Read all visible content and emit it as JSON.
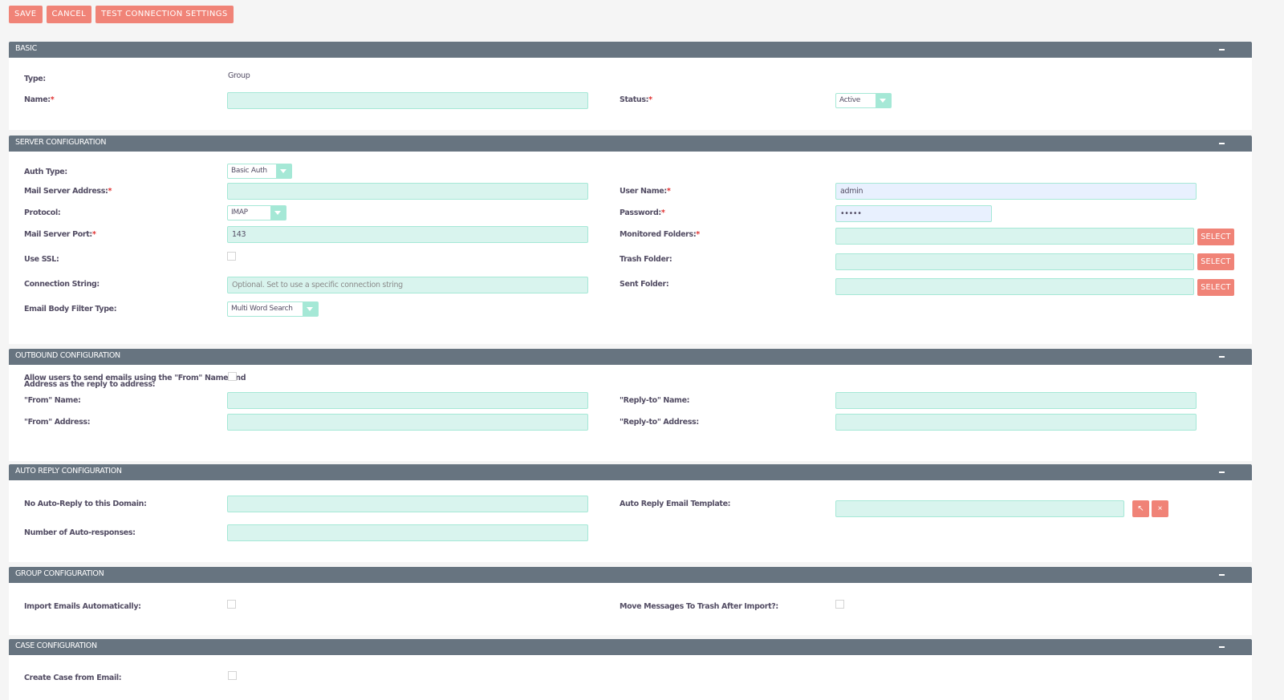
{
  "toolbar": {
    "save_label": "SAVE",
    "cancel_label": "CANCEL",
    "test_label": "TEST CONNECTION SETTINGS"
  },
  "basic": {
    "title": "BASIC",
    "type_label": "Type:",
    "type_value": "Group",
    "name_label": "Name:",
    "name_value": "",
    "status_label": "Status:",
    "status_value": "Active"
  },
  "server": {
    "title": "SERVER CONFIGURATION",
    "auth_type_label": "Auth Type:",
    "auth_type_value": "Basic Auth",
    "mail_server_address_label": "Mail Server Address:",
    "mail_server_address_value": "",
    "protocol_label": "Protocol:",
    "protocol_value": "IMAP",
    "port_label": "Mail Server Port:",
    "port_value": "143",
    "use_ssl_label": "Use SSL:",
    "use_ssl_checked": false,
    "connection_string_label": "Connection String:",
    "connection_string_placeholder": "Optional. Set to use a specific connection string",
    "filter_type_label": "Email Body Filter Type:",
    "filter_type_value": "Multi Word Search",
    "user_name_label": "User Name:",
    "user_name_value": "admin",
    "password_label": "Password:",
    "password_value": "•••••",
    "monitored_folders_label": "Monitored Folders:",
    "trash_folder_label": "Trash Folder:",
    "sent_folder_label": "Sent Folder:",
    "select_label": "SELECT"
  },
  "outbound": {
    "title": "OUTBOUND CONFIGURATION",
    "allow_label_line1": "Allow users to send emails using the \"From\" Name and",
    "allow_label_line2": "Address as the reply to address:",
    "from_name_label": "\"From\" Name:",
    "from_address_label": "\"From\" Address:",
    "reply_name_label": "\"Reply-to\" Name:",
    "reply_address_label": "\"Reply-to\" Address:"
  },
  "auto_reply": {
    "title": "AUTO REPLY CONFIGURATION",
    "no_domain_label": "No Auto-Reply to this Domain:",
    "num_responses_label": "Number of Auto-responses:",
    "template_label": "Auto Reply Email Template:",
    "select_icon": "↖",
    "clear_icon": "×"
  },
  "group": {
    "title": "GROUP CONFIGURATION",
    "import_label": "Import Emails Automatically:",
    "move_label": "Move Messages To Trash After Import?:"
  },
  "case": {
    "title": "CASE CONFIGURATION",
    "create_case_label": "Create Case from Email:"
  },
  "required_marker": "*"
}
